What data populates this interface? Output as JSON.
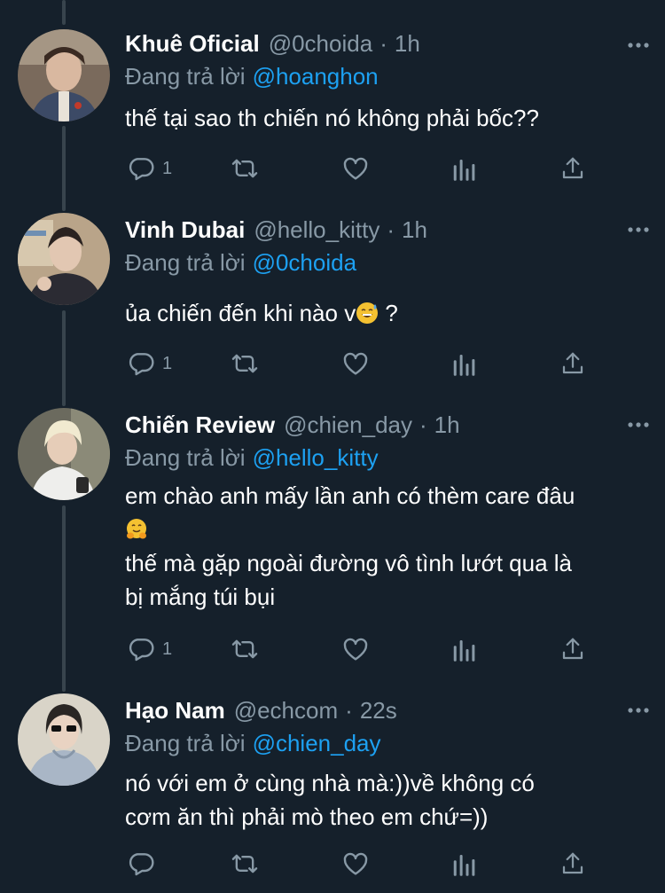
{
  "colors": {
    "background": "#15202b",
    "secondary_text": "#8899a6",
    "link": "#1da1f2",
    "thread_line": "#38444d"
  },
  "tweets": [
    {
      "name": "Khuê Oficial",
      "handle": "@0choida",
      "time": "1h",
      "reply_prefix": "Đang trả lời",
      "reply_to": "@hoanghon",
      "lines": [
        "thế tại sao th chiến nó không phải bốc??"
      ],
      "reply_count": "1"
    },
    {
      "name": "Vinh Dubai",
      "handle": "@hello_kitty",
      "time": "1h",
      "reply_prefix": "Đang trả lời",
      "reply_to": "@0choida",
      "text_before_emoji": "ủa chiến đến khi nào v",
      "text_after_emoji": " ?",
      "emoji": "grinning-sweat-emoji",
      "reply_count": "1"
    },
    {
      "name": "Chiến Review",
      "handle": "@chien_day",
      "time": "1h",
      "reply_prefix": "Đang trả lời",
      "reply_to": "@hello_kitty",
      "line1": "em chào anh mấy lần anh có thèm care đâu",
      "emoji": "hugging-face-emoji",
      "line3": "thế mà gặp ngoài đường vô tình lướt qua là",
      "line4": "bị mắng túi bụi",
      "reply_count": "1"
    },
    {
      "name": "Hạo Nam",
      "handle": "@echcom",
      "time": "22s",
      "reply_prefix": "Đang trả lời",
      "reply_to": "@chien_day",
      "line1": "nó với em ở cùng nhà mà:))về không có",
      "line2": "cơm ăn thì phải mò theo em chứ=))",
      "reply_count": ""
    }
  ],
  "icons": {
    "reply": "reply-icon",
    "retweet": "retweet-icon",
    "like": "heart-icon",
    "analytics": "analytics-icon",
    "share": "share-icon",
    "more": "more-icon"
  }
}
